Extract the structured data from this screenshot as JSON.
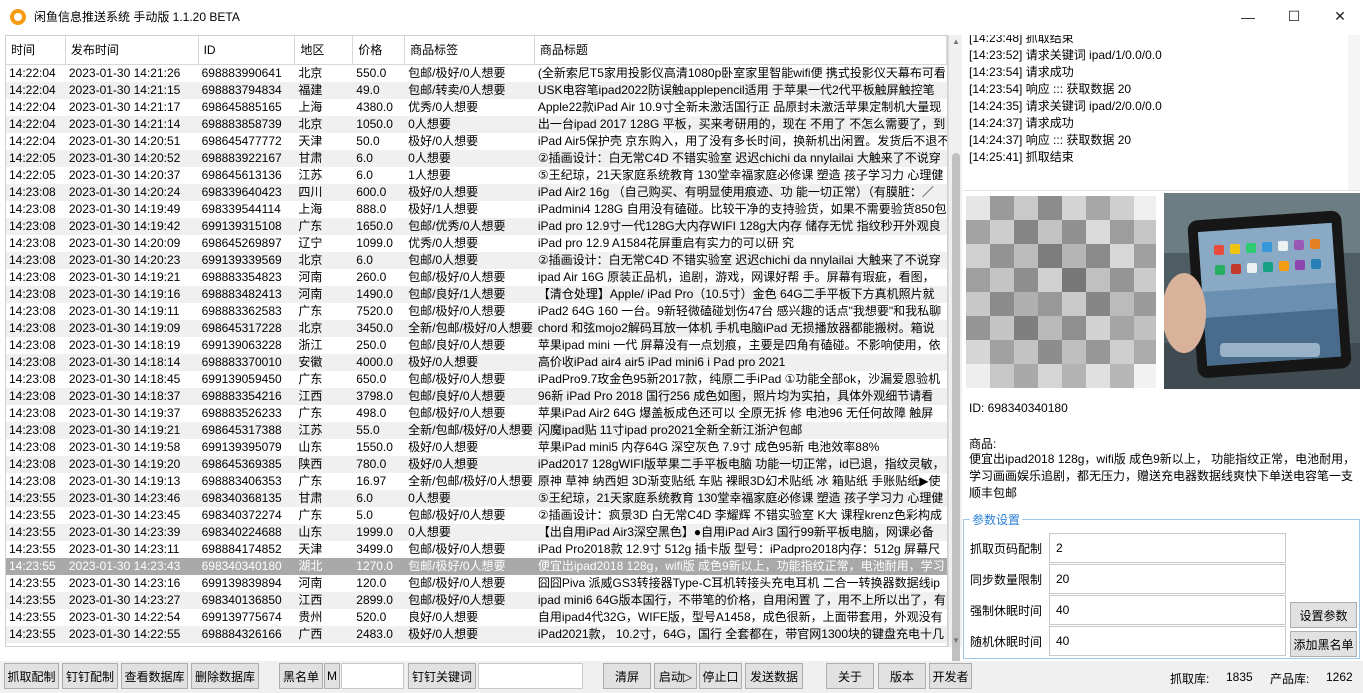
{
  "window": {
    "title": "闲鱼信息推送系统 手动版 1.1.20 BETA"
  },
  "table": {
    "columns": [
      "时间",
      "发布时间",
      "ID",
      "地区",
      "价格",
      "商品标签",
      "商品标题"
    ],
    "rows": [
      [
        "14:22:04",
        "2023-01-30 14:21:26",
        "698883990641",
        "北京",
        "550.0",
        "包邮/极好/0人想要",
        "(全新索尼T5家用投影仪高清1080p卧室家里智能wifi便 携式投影仪天幕布可看"
      ],
      [
        "14:22:04",
        "2023-01-30 14:21:15",
        "698883794834",
        "福建",
        "49.0",
        "包邮/转卖/0人想要",
        "USK电容笔ipad2022防误触applepencil适用 于苹果一代2代平板触屏触控笔"
      ],
      [
        "14:22:04",
        "2023-01-30 14:21:17",
        "698645885165",
        "上海",
        "4380.0",
        "优秀/0人想要",
        "Apple22款iPad Air 10.9寸全新未激活国行正 品原封未激活苹果定制机大量现"
      ],
      [
        "14:22:04",
        "2023-01-30 14:21:14",
        "698883858739",
        "北京",
        "1050.0",
        "0人想要",
        "出一台ipad 2017 128G 平板，买来考研用的，现在 不用了 不怎么需要了，到"
      ],
      [
        "14:22:04",
        "2023-01-30 14:20:51",
        "698645477772",
        "天津",
        "50.0",
        "极好/0人想要",
        "iPad Air5保护壳 京东购入，用了没有多长时间，换新机出闲置。发货后不退不"
      ],
      [
        "14:22:05",
        "2023-01-30 14:20:52",
        "698883922167",
        "甘肃",
        "6.0",
        "0人想要",
        "②插画设计：白无常C4D 不错实验室 迟迟chichi da nnylailai 大触来了不说穿"
      ],
      [
        "14:22:05",
        "2023-01-30 14:20:37",
        "698645613136",
        "江苏",
        "6.0",
        "1人想要",
        "⑤王纪琼，21天家庭系统教育 130堂幸福家庭必修课 塑造 孩子学习力 心理健"
      ],
      [
        "14:23:08",
        "2023-01-30 14:20:24",
        "698339640423",
        "四川",
        "600.0",
        "极好/0人想要",
        "iPad Air2 16g （自己购买、有明显使用痕迹、功 能一切正常）（有膜脏：／"
      ],
      [
        "14:23:08",
        "2023-01-30 14:19:49",
        "698339544114",
        "上海",
        "888.0",
        "极好/1人想要",
        "iPadmini4 128G 自用没有磕碰。比较干净的支持验货，如果不需要验货850包"
      ],
      [
        "14:23:08",
        "2023-01-30 14:19:42",
        "699139315108",
        "广东",
        "1650.0",
        "包邮/优秀/0人想要",
        "iPad pro 12.9寸一代128G大内存WIFI 128g大内存 储存无忧 指纹秒开外观良"
      ],
      [
        "14:23:08",
        "2023-01-30 14:20:09",
        "698645269897",
        "辽宁",
        "1099.0",
        "优秀/0人想要",
        "iPad pro 12.9 A1584花屏重启有实力的可以研 究"
      ],
      [
        "14:23:08",
        "2023-01-30 14:20:23",
        "699139339569",
        "北京",
        "6.0",
        "包邮/0人想要",
        "②插画设计：白无常C4D 不错实验室 迟迟chichi da nnylailai 大触来了不说穿"
      ],
      [
        "14:23:08",
        "2023-01-30 14:19:21",
        "698883354823",
        "河南",
        "260.0",
        "包邮/极好/0人想要",
        "ipad Air 16G 原装正品机，追剧，游戏，网课好帮 手。屏幕有瑕疵，看图，"
      ],
      [
        "14:23:08",
        "2023-01-30 14:19:16",
        "698883482413",
        "河南",
        "1490.0",
        "包邮/良好/1人想要",
        "【清仓处理】Apple/ iPad Pro（10.5寸）金色 64G二手平板下方真机照片就"
      ],
      [
        "14:23:08",
        "2023-01-30 14:19:11",
        "698883362583",
        "广东",
        "7520.0",
        "包邮/极好/0人想要",
        "iPad2 64G 160 一台。9新轻微磕碰划伤47台 感兴趣的话点\"我想要\"和我私聊"
      ],
      [
        "14:23:08",
        "2023-01-30 14:19:09",
        "698645317228",
        "北京",
        "3450.0",
        "全新/包邮/极好/0人想要",
        "chord 和弦mojo2解码耳放一体机 手机电脑iPad 无损播放器都能搬树。箱说"
      ],
      [
        "14:23:08",
        "2023-01-30 14:18:19",
        "699139063228",
        "浙江",
        "250.0",
        "包邮/良好/0人想要",
        "苹果ipad mini 一代 屏幕没有一点划痕，主要是四角有磕碰。不影响使用，依"
      ],
      [
        "14:23:08",
        "2023-01-30 14:18:14",
        "698883370010",
        "安徽",
        "4000.0",
        "极好/0人想要",
        "高价收iPad air4 air5 iPad mini6 i Pad pro 2021"
      ],
      [
        "14:23:08",
        "2023-01-30 14:18:45",
        "699139059450",
        "广东",
        "650.0",
        "包邮/极好/0人想要",
        "iPadPro9.7玫金色95新2017款，纯原二手iPad ①功能全部ok，沙漏爱恩验机"
      ],
      [
        "14:23:08",
        "2023-01-30 14:18:37",
        "698883354216",
        "江西",
        "3798.0",
        "包邮/良好/0人想要",
        "96新 iPad Pro 2018  国行256 成色如图，照片均为实拍，具体外观细节请看"
      ],
      [
        "14:23:08",
        "2023-01-30 14:19:37",
        "698883526233",
        "广东",
        "498.0",
        "包邮/极好/0人想要",
        "苹果iPad Air2 64G 爆盖板成色还可以  全原无拆 修 电池96 无任何故障  触屏"
      ],
      [
        "14:23:08",
        "2023-01-30 14:19:21",
        "698645317388",
        "江苏",
        "55.0",
        "全新/包邮/极好/0人想要",
        "闪魔ipad贴 11寸ipad pro2021全新全新江浙沪包邮"
      ],
      [
        "14:23:08",
        "2023-01-30 14:19:58",
        "699139395079",
        "山东",
        "1550.0",
        "极好/0人想要",
        "苹果iPad mini5 内存64G 深空灰色 7.9寸 成色95新 电池效率88%"
      ],
      [
        "14:23:08",
        "2023-01-30 14:19:20",
        "698645369385",
        "陕西",
        "780.0",
        "极好/0人想要",
        "iPad2017 128gWIFI版苹果二手平板电脑 功能一切正常，id已退，指纹灵敏，"
      ],
      [
        "14:23:08",
        "2023-01-30 14:19:13",
        "698883406353",
        "广东",
        "16.97",
        "全新/包邮/极好/0人想要",
        "原神 草神 纳西妲 3D渐变贴纸 车贴 裸眼3D幻术贴纸 冰 箱贴纸 手账贴纸▶使"
      ],
      [
        "14:23:55",
        "2023-01-30 14:23:46",
        "698340368135",
        "甘肃",
        "6.0",
        "0人想要",
        "⑤王纪琼，21天家庭系统教育 130堂幸福家庭必修课 塑造 孩子学习力 心理健"
      ],
      [
        "14:23:55",
        "2023-01-30 14:23:45",
        "698340372274",
        "广东",
        "5.0",
        "包邮/极好/0人想要",
        "②插画设计：疯景3D 白无常C4D 李耀辉 不错实验室 K大 课程krenz色彩构成"
      ],
      [
        "14:23:55",
        "2023-01-30 14:23:39",
        "698340224688",
        "山东",
        "1999.0",
        "0人想要",
        "【出自用iPad Air3深空黑色】●自用iPad Air3 国行99新平板电脑，网课必备"
      ],
      [
        "14:23:55",
        "2023-01-30 14:23:11",
        "698884174852",
        "天津",
        "3499.0",
        "包邮/极好/0人想要",
        "iPad Pro2018款 12.9寸 512g 插卡版 型号：iPadpro2018内存：512g 屏幕尺"
      ],
      [
        "14:23:55",
        "2023-01-30 14:23:43",
        "698340340180",
        "湖北",
        "1270.0",
        "包邮/极好/0人想要",
        "便宜出ipad2018 128g，wifi版 成色9新以上，功能指纹正常，电池耐用，学习"
      ],
      [
        "14:23:55",
        "2023-01-30 14:23:16",
        "699139839894",
        "河南",
        "120.0",
        "包邮/极好/0人想要",
        "囧囧Piva 派威GS3转接器Type-C耳机转接头充电耳机 二合一转换器数据线ip"
      ],
      [
        "14:23:55",
        "2023-01-30 14:23:27",
        "698340136850",
        "江西",
        "2899.0",
        "包邮/极好/0人想要",
        "ipad mini6 64G版本国行，不带笔的价格，自用闲置 了，用不上所以出了，有"
      ],
      [
        "14:23:55",
        "2023-01-30 14:22:54",
        "699139775674",
        "贵州",
        "520.0",
        "良好/0人想要",
        "自用ipad4代32G，WIFE版，型号A1458，成色很新，上面带套用，外观没有"
      ],
      [
        "14:23:55",
        "2023-01-30 14:22:55",
        "698884326166",
        "广西",
        "2483.0",
        "极好/0人想要",
        "iPad2021款， 10.2寸，64G，国行 全套都在，带官网1300块的键盘充电十几"
      ]
    ],
    "selected_index": 29
  },
  "log": [
    "[14:23:48]  抓取结束",
    "[14:23:52]  请求关键词 ipad/1/0.0/0.0",
    "[14:23:54]  请求成功",
    "[14:23:54]  响应 ::: 获取数据 20",
    "[14:24:35]  请求关键词 ipad/2/0.0/0.0",
    "[14:24:37]  请求成功",
    "[14:24:37]  响应 ::: 获取数据 20",
    "[14:25:41]  抓取结束"
  ],
  "detail": {
    "id_text": "ID: 698340340180",
    "goods_label": "商品:",
    "goods_text": "便宜出ipad2018 128g，wifi版 成色9新以上， 功能指纹正常，电池耐用，学习画画娱乐追剧，都无压力，赠送充电器数据线爽快下单送电容笔一支 顺丰包邮"
  },
  "params": {
    "legend": "参数设置",
    "fields": [
      {
        "label": "抓取页码配制",
        "value": "2"
      },
      {
        "label": "同步数量限制",
        "value": "20"
      },
      {
        "label": "强制休眠时间",
        "value": "40"
      },
      {
        "label": "随机休眠时间",
        "value": "40"
      }
    ],
    "set_button": "设置参数",
    "blacklist_button": "添加黑名单"
  },
  "toolbar": {
    "b1": "抓取配制",
    "b2": "钉钉配制",
    "b3": "查看数据库",
    "b4": "删除数据库",
    "b5": "黑名单",
    "b6": "M",
    "b7": "钉钉关键词",
    "b8": "清屏",
    "b9": "启动▷",
    "b10": "停止口",
    "b11": "发送数据",
    "b12": "关于",
    "b13": "版本",
    "b14": "开发者",
    "stat1_label": "抓取库:",
    "stat1_value": "1835",
    "stat2_label": "产品库:",
    "stat2_value": "1262"
  }
}
